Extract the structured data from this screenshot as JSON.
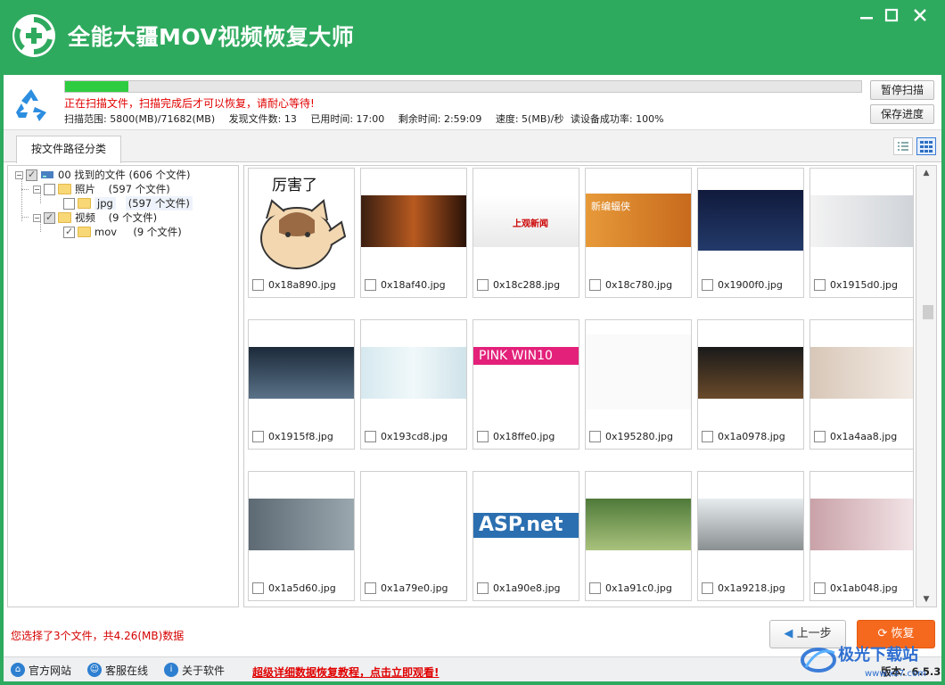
{
  "app": {
    "title": "全能大疆MOV视频恢复大师"
  },
  "scan": {
    "progress": 0.08,
    "message": "正在扫描文件，扫描完成后才可以恢复，请耐心等待!",
    "range": "扫描范围: 5800(MB)/71682(MB)",
    "found": "发现文件数: 13",
    "elapsed": "已用时间: 17:00",
    "remaining": "剩余时间: 2:59:09",
    "speed": "速度: 5(MB)/秒",
    "success": "读设备成功率: 100%",
    "pause_label": "暂停扫描",
    "save_label": "保存进度"
  },
  "tabs": {
    "path_tab": "按文件路径分类"
  },
  "tree": {
    "root": {
      "name": "00 找到的文件",
      "count": "(606 个文件)"
    },
    "photos": {
      "name": "照片",
      "count": "(597 个文件)"
    },
    "jpg": {
      "name": "jpg",
      "count": "(597 个文件)"
    },
    "videos": {
      "name": "视频",
      "count": "(9 个文件)"
    },
    "mov": {
      "name": "mov",
      "count": "(9 个文件)"
    }
  },
  "files": [
    {
      "name": "0x18a890.jpg",
      "thumb_text": "厉害了"
    },
    {
      "name": "0x18af40.jpg"
    },
    {
      "name": "0x18c288.jpg",
      "thumb_text": "上观新闻"
    },
    {
      "name": "0x18c780.jpg",
      "thumb_text": "新编蝠侠"
    },
    {
      "name": "0x1900f0.jpg"
    },
    {
      "name": "0x1915d0.jpg"
    },
    {
      "name": "0x1915f8.jpg"
    },
    {
      "name": "0x193cd8.jpg"
    },
    {
      "name": "0x18ffe0.jpg",
      "thumb_text": "PINK WIN10"
    },
    {
      "name": "0x195280.jpg"
    },
    {
      "name": "0x1a0978.jpg"
    },
    {
      "name": "0x1a4aa8.jpg"
    },
    {
      "name": "0x1a5d60.jpg"
    },
    {
      "name": "0x1a79e0.jpg"
    },
    {
      "name": "0x1a90e8.jpg",
      "thumb_text": "ASP.net"
    },
    {
      "name": "0x1a91c0.jpg"
    },
    {
      "name": "0x1a9218.jpg"
    },
    {
      "name": "0x1ab048.jpg"
    }
  ],
  "selection": {
    "info": "您选择了3个文件，共4.26(MB)数据"
  },
  "actions": {
    "prev_label": "上一步",
    "recover_label": "恢复"
  },
  "footer": {
    "website": "官方网站",
    "support": "客服在线",
    "about": "关于软件",
    "promo": "超级详细数据恢复教程，点击立即观看!",
    "version": "版本：6.5.3"
  },
  "watermark": {
    "text": "极光下载站",
    "url": "www.xz7.com"
  },
  "colors": {
    "brand": "#2eaa5e",
    "accent": "#f5691f",
    "warning": "#e10000"
  }
}
